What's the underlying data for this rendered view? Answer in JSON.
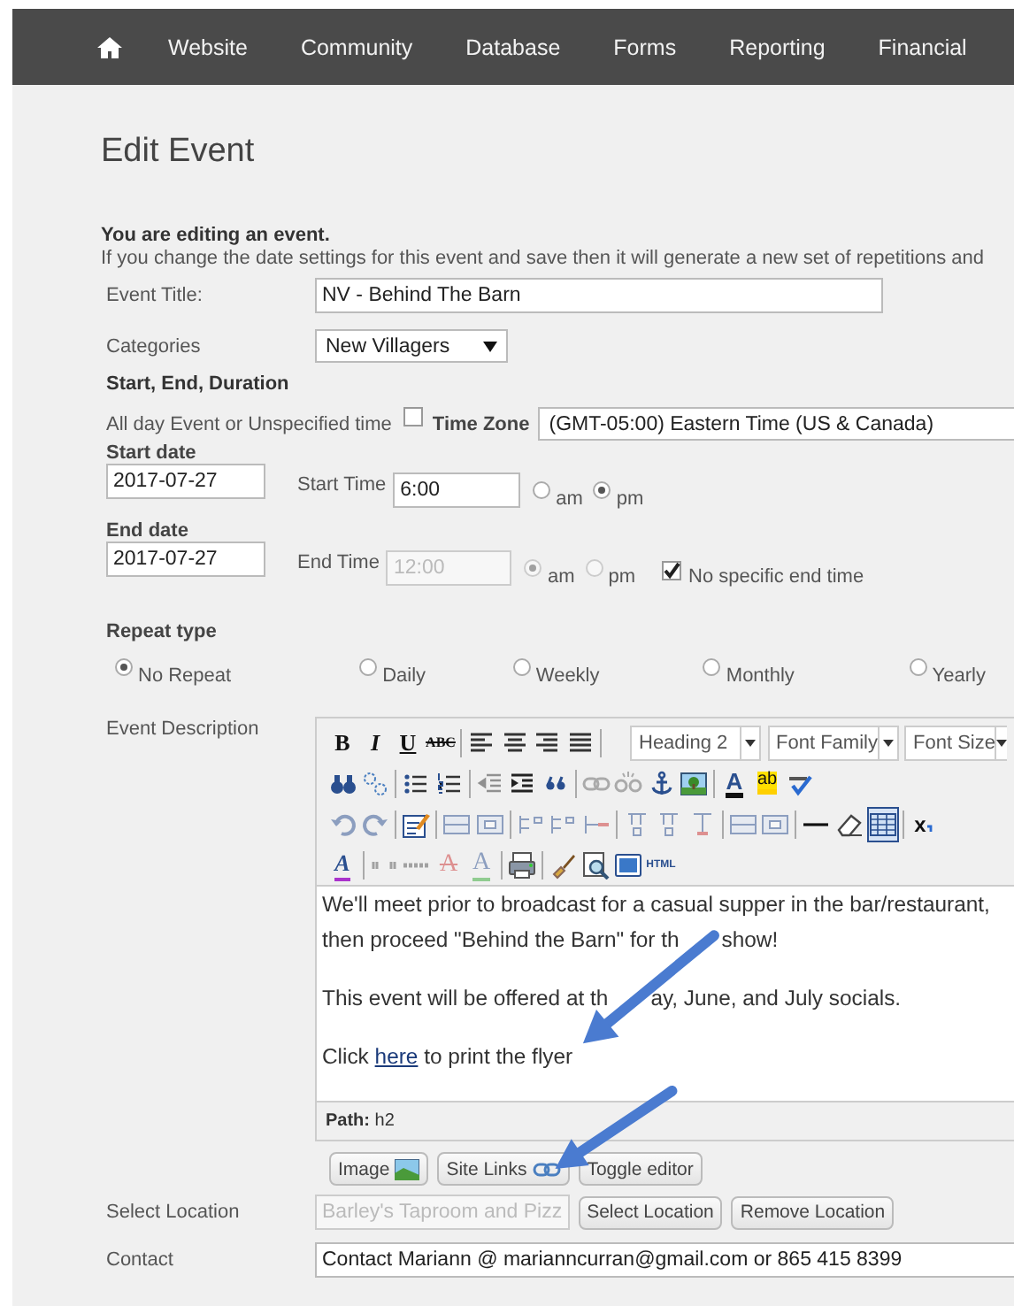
{
  "nav": {
    "items": [
      "Website",
      "Community",
      "Database",
      "Forms",
      "Reporting",
      "Financial"
    ]
  },
  "page_title": "Edit Event",
  "notice": {
    "heading": "You are editing an event.",
    "text": "If you change the date settings for this event and save then it will generate a new set of repetitions and"
  },
  "event_title": {
    "label": "Event Title:",
    "value": "NV - Behind The Barn"
  },
  "categories": {
    "label": "Categories",
    "value": "New Villagers"
  },
  "duration_heading": "Start, End, Duration",
  "all_day": {
    "label": "All day Event or Unspecified time",
    "checked": false
  },
  "time_zone": {
    "label": "Time Zone",
    "value": "(GMT-05:00) Eastern Time (US & Canada)"
  },
  "start": {
    "date_label": "Start date",
    "date": "2017-07-27",
    "time_label": "Start Time",
    "time": "6:00",
    "disabled": false,
    "meridiem": [
      {
        "label": "am",
        "selected": false
      },
      {
        "label": "pm",
        "selected": true
      }
    ]
  },
  "end": {
    "date_label": "End date",
    "date": "2017-07-27",
    "time_label": "End Time",
    "time": "12:00",
    "disabled": true,
    "meridiem": [
      {
        "label": "am",
        "selected": true
      },
      {
        "label": "pm",
        "selected": false
      }
    ],
    "no_end_time": {
      "label": "No specific end time",
      "checked": true
    }
  },
  "repeat": {
    "heading": "Repeat type",
    "options": [
      {
        "label": "No Repeat",
        "selected": true
      },
      {
        "label": "Daily",
        "selected": false
      },
      {
        "label": "Weekly",
        "selected": false
      },
      {
        "label": "Monthly",
        "selected": false
      },
      {
        "label": "Yearly",
        "selected": false
      }
    ]
  },
  "description": {
    "label": "Event Description",
    "toolbar": [
      [
        {
          "kind": "bold",
          "text": "B",
          "disabled": false
        },
        {
          "kind": "italic",
          "text": "I",
          "disabled": false
        },
        {
          "kind": "underline",
          "text": "U",
          "disabled": false
        },
        {
          "kind": "strikethrough",
          "text": "ABC",
          "disabled": false
        },
        {
          "kind": "sep"
        },
        {
          "kind": "align-left",
          "disabled": false
        },
        {
          "kind": "align-center",
          "disabled": false
        },
        {
          "kind": "align-right",
          "disabled": false
        },
        {
          "kind": "align-justify",
          "disabled": false
        },
        {
          "kind": "sep"
        },
        {
          "kind": "select",
          "value": "Heading 2"
        },
        {
          "kind": "select",
          "value": "Font Family"
        },
        {
          "kind": "select",
          "value": "Font Size"
        }
      ],
      [
        {
          "kind": "binoculars",
          "disabled": false
        },
        {
          "kind": "replace",
          "disabled": false
        },
        {
          "kind": "sep"
        },
        {
          "kind": "bullet-list",
          "disabled": false
        },
        {
          "kind": "numbered-list",
          "disabled": false
        },
        {
          "kind": "sep"
        },
        {
          "kind": "outdent",
          "disabled": true
        },
        {
          "kind": "indent",
          "disabled": false
        },
        {
          "kind": "quote",
          "disabled": false
        },
        {
          "kind": "sep"
        },
        {
          "kind": "link",
          "disabled": true
        },
        {
          "kind": "unlink",
          "disabled": true
        },
        {
          "kind": "anchor",
          "disabled": false
        },
        {
          "kind": "image",
          "disabled": false
        },
        {
          "kind": "sep"
        },
        {
          "kind": "text-color",
          "text": "A",
          "disabled": false
        },
        {
          "kind": "highlight",
          "text": "ab",
          "disabled": false
        },
        {
          "kind": "spellcheck",
          "disabled": false
        }
      ],
      [
        {
          "kind": "undo",
          "disabled": true
        },
        {
          "kind": "redo",
          "disabled": true
        },
        {
          "kind": "sep"
        },
        {
          "kind": "edit",
          "disabled": false
        },
        {
          "kind": "sep"
        },
        {
          "kind": "table-row",
          "disabled": true
        },
        {
          "kind": "table-cell",
          "disabled": true
        },
        {
          "kind": "sep"
        },
        {
          "kind": "row-insert",
          "disabled": true
        },
        {
          "kind": "row-insert",
          "disabled": true
        },
        {
          "kind": "row-delete",
          "disabled": true
        },
        {
          "kind": "sep"
        },
        {
          "kind": "column-insert",
          "disabled": true
        },
        {
          "kind": "column-insert",
          "disabled": true
        },
        {
          "kind": "column-delete",
          "disabled": true
        },
        {
          "kind": "sep"
        },
        {
          "kind": "table-row",
          "disabled": true
        },
        {
          "kind": "table-cell",
          "disabled": true
        },
        {
          "kind": "sep"
        },
        {
          "kind": "horizontal-rule",
          "disabled": false
        },
        {
          "kind": "eraser",
          "disabled": false
        },
        {
          "kind": "table",
          "disabled": false,
          "selected": true
        },
        {
          "kind": "sep"
        },
        {
          "kind": "subscript",
          "text": "x",
          "disabled": false
        }
      ],
      [
        {
          "kind": "styles",
          "text": "A",
          "disabled": false
        },
        {
          "kind": "sep"
        },
        {
          "kind": "quote-marks",
          "disabled": true
        },
        {
          "kind": "abbreviation",
          "disabled": true
        },
        {
          "kind": "strike-letter",
          "text": "A",
          "disabled": true
        },
        {
          "kind": "letter",
          "text": "A",
          "disabled": true
        },
        {
          "kind": "sep"
        },
        {
          "kind": "print",
          "disabled": false
        },
        {
          "kind": "sep"
        },
        {
          "kind": "brush",
          "disabled": false
        },
        {
          "kind": "preview",
          "disabled": false
        },
        {
          "kind": "fullscreen",
          "disabled": false
        },
        {
          "kind": "html",
          "text": "HTML",
          "disabled": false
        }
      ]
    ],
    "content": [
      {
        "lines": [
          [
            "We'll meet prior to broadcast for a casual supper in the bar/restaurant,"
          ],
          [
            "then proceed \"Behind the Barn\" for th",
            "show!"
          ]
        ]
      },
      {
        "lines": [
          [
            "This event will be offered at th",
            "ay, June, and July socials."
          ]
        ]
      },
      {
        "before": "Click ",
        "link": "here",
        "after": " to print the flyer"
      }
    ],
    "path": "**Path:** h2"
  },
  "editor_buttons": [
    {
      "kind": "image",
      "label": "Image"
    },
    {
      "kind": "link",
      "label": "Site Links"
    },
    {
      "kind": "plain",
      "label": "Toggle editor"
    }
  ],
  "location": {
    "label": "Select Location",
    "value": "Barley's Taproom and Pizz",
    "disabled": true,
    "buttons": [
      "Select Location",
      "Remove Location"
    ]
  },
  "contact": {
    "label": "Contact",
    "value": "Contact Mariann @ marianncurran@gmail.com or 865 415 8399"
  }
}
